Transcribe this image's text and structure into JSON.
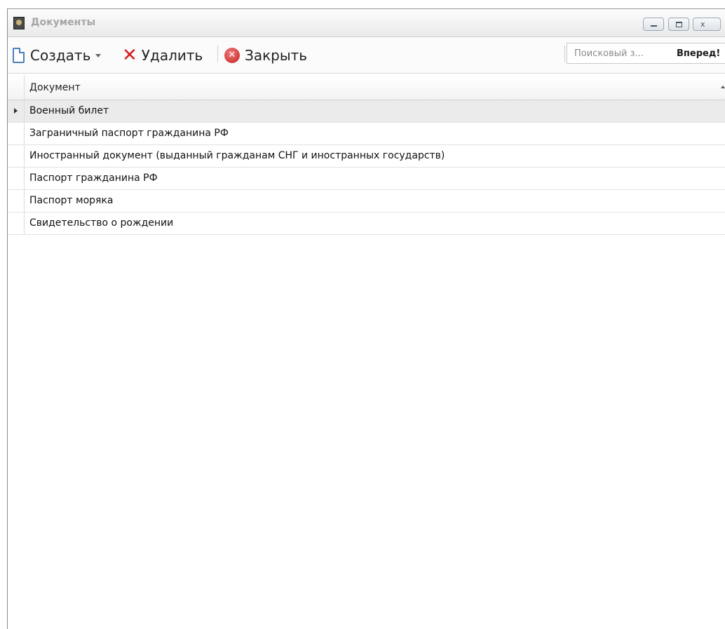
{
  "window": {
    "title": "Документы"
  },
  "toolbar": {
    "create_label": "Создать",
    "delete_label": "Удалить",
    "close_label": "Закрыть",
    "delete_glyph": "✕",
    "close_glyph": "✕",
    "accent_delete": "#d61e1e",
    "accent_close": "#c42020"
  },
  "search": {
    "placeholder": "Поисковый з...",
    "forward_label": "Вперед!"
  },
  "grid": {
    "column_header": "Документ",
    "rows": [
      "Военный билет",
      "Заграничный паспорт гражданина РФ",
      "Иностранный документ (выданный гражданам СНГ и иностранных государств)",
      "Паспорт гражданина РФ",
      "Паспорт моряка",
      "Свидетельство о рождении"
    ],
    "selected_index": 0
  }
}
